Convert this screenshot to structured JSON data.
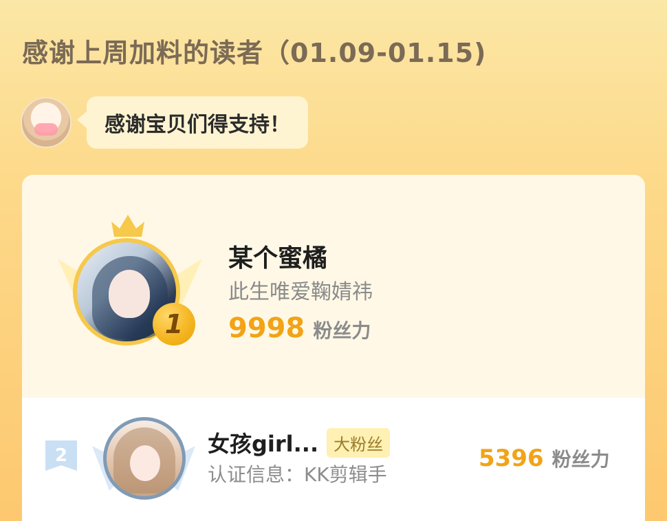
{
  "header": {
    "title": "感谢上周加料的读者（01.09-01.15)"
  },
  "bubble": {
    "text": "感谢宝贝们得支持！"
  },
  "ranking": {
    "first": {
      "rank": "1",
      "name": "某个蜜橘",
      "subtitle": "此生唯爱鞠婧祎",
      "score": "9998",
      "unit": "粉丝力"
    },
    "second": {
      "rank": "2",
      "name": "女孩girl...",
      "tag": "大粉丝",
      "subtitle": "认证信息：KK剪辑手",
      "score": "5396",
      "unit": "粉丝力"
    }
  },
  "colors": {
    "accent": "#f2a316",
    "header_text": "#7b6a55",
    "card_bg": "#fff8e6",
    "rank2_badge": "#c9dff4"
  },
  "icons": {
    "crown": "crown-icon",
    "wings": "wings-icon",
    "medal": "medal-icon",
    "avatar": "avatar"
  }
}
